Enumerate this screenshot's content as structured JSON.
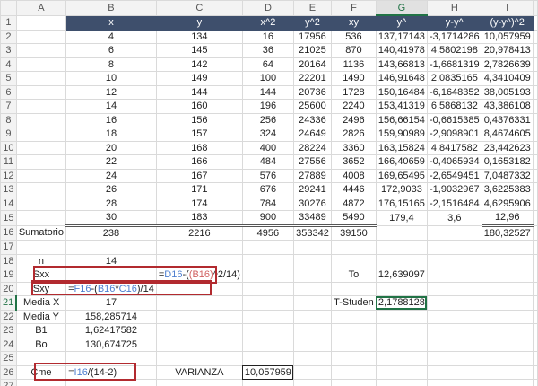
{
  "columns": [
    "A",
    "B",
    "C",
    "D",
    "E",
    "F",
    "G",
    "H",
    "I"
  ],
  "headers": [
    "x",
    "y",
    "x^2",
    "y^2",
    "xy",
    "y^",
    "y-y^",
    "(y-y^)^2"
  ],
  "rows": [
    [
      "4",
      "134",
      "16",
      "17956",
      "536",
      "137,17143",
      "-3,1714286",
      "10,057959"
    ],
    [
      "6",
      "145",
      "36",
      "21025",
      "870",
      "140,41978",
      "4,5802198",
      "20,978413"
    ],
    [
      "8",
      "142",
      "64",
      "20164",
      "1136",
      "143,66813",
      "-1,6681319",
      "2,7826639"
    ],
    [
      "10",
      "149",
      "100",
      "22201",
      "1490",
      "146,91648",
      "2,0835165",
      "4,3410409"
    ],
    [
      "12",
      "144",
      "144",
      "20736",
      "1728",
      "150,16484",
      "-6,1648352",
      "38,005193"
    ],
    [
      "14",
      "160",
      "196",
      "25600",
      "2240",
      "153,41319",
      "6,5868132",
      "43,386108"
    ],
    [
      "16",
      "156",
      "256",
      "24336",
      "2496",
      "156,66154",
      "-0,6615385",
      "0,4376331"
    ],
    [
      "18",
      "157",
      "324",
      "24649",
      "2826",
      "159,90989",
      "-2,9098901",
      "8,4674605"
    ],
    [
      "20",
      "168",
      "400",
      "28224",
      "3360",
      "163,15824",
      "4,8417582",
      "23,442623"
    ],
    [
      "22",
      "166",
      "484",
      "27556",
      "3652",
      "166,40659",
      "-0,4065934",
      "0,1653182"
    ],
    [
      "24",
      "167",
      "576",
      "27889",
      "4008",
      "169,65495",
      "-2,6549451",
      "7,0487332"
    ],
    [
      "26",
      "171",
      "676",
      "29241",
      "4446",
      "172,9033",
      "-1,9032967",
      "3,6225383"
    ],
    [
      "28",
      "174",
      "784",
      "30276",
      "4872",
      "176,15165",
      "-2,1516484",
      "4,6295906"
    ],
    [
      "30",
      "183",
      "900",
      "33489",
      "5490",
      "179,4",
      "3,6",
      "12,96"
    ]
  ],
  "sum": {
    "label": "Sumatorio",
    "b": "238",
    "c": "2216",
    "d": "4956",
    "e": "353342",
    "f": "39150",
    "i": "180,32527"
  },
  "stats": {
    "n_label": "n",
    "n": "14",
    "sxx_label": "Sxx",
    "sxx_formula": [
      "=",
      "D16",
      "-(",
      "(B16)",
      "^2/14)"
    ],
    "sxy_label": "Sxy",
    "sxy_formula": [
      "=",
      "F16",
      "-(",
      "B16",
      "*",
      "C16",
      ")/14"
    ],
    "mediax_label": "Media X",
    "mediax": "17",
    "mediay_label": "Media Y",
    "mediay": "158,285714",
    "b1_label": "B1",
    "b1": "1,62417582",
    "bo_label": "Bo",
    "bo": "130,674725",
    "cme_label": "Cme",
    "cme_formula": [
      "=",
      "I16",
      "/(14-2)"
    ],
    "varianza_label": "VARIANZA",
    "varianza": "10,057959",
    "to_label": "To",
    "to": "12,639097",
    "tstud_label": "T-Studen",
    "tstud": "2,1788128"
  }
}
